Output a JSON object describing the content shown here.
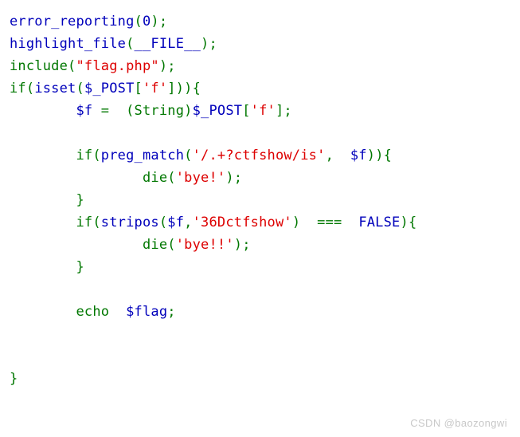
{
  "page": {
    "background_color": "#ffffff",
    "kind": "php-highlighted-source"
  },
  "theme": {
    "identifier_color": "#0000BB",
    "keyword_color": "#007700",
    "string_color": "#DD0000",
    "watermark_color": "#c8c8c8"
  },
  "code": {
    "language": "php",
    "lines": [
      {
        "index": 0,
        "indent": 0,
        "text": "error_reporting(0);",
        "tokens": [
          {
            "t": "error_reporting",
            "c": "fn"
          },
          {
            "t": "(",
            "c": "punc"
          },
          {
            "t": "0",
            "c": "num"
          },
          {
            "t": ")",
            "c": "punc"
          },
          {
            "t": ";",
            "c": "punc"
          }
        ]
      },
      {
        "index": 1,
        "indent": 0,
        "text": "highlight_file(__FILE__);",
        "tokens": [
          {
            "t": "highlight_file",
            "c": "fn"
          },
          {
            "t": "(",
            "c": "punc"
          },
          {
            "t": "__FILE__",
            "c": "def"
          },
          {
            "t": ")",
            "c": "punc"
          },
          {
            "t": ";",
            "c": "punc"
          }
        ]
      },
      {
        "index": 2,
        "indent": 0,
        "text": "include(\"flag.php\");",
        "tokens": [
          {
            "t": "include",
            "c": "kw"
          },
          {
            "t": "(",
            "c": "punc"
          },
          {
            "t": "\"flag.php\"",
            "c": "str"
          },
          {
            "t": ")",
            "c": "punc"
          },
          {
            "t": ";",
            "c": "punc"
          }
        ]
      },
      {
        "index": 3,
        "indent": 0,
        "text": "if(isset($_POST['f'])){",
        "tokens": [
          {
            "t": "if",
            "c": "kw"
          },
          {
            "t": "(",
            "c": "punc"
          },
          {
            "t": "isset",
            "c": "fn"
          },
          {
            "t": "(",
            "c": "punc"
          },
          {
            "t": "$_POST",
            "c": "var"
          },
          {
            "t": "[",
            "c": "punc"
          },
          {
            "t": "'f'",
            "c": "str"
          },
          {
            "t": "]",
            "c": "punc"
          },
          {
            "t": ")",
            "c": "punc"
          },
          {
            "t": ")",
            "c": "punc"
          },
          {
            "t": "{",
            "c": "punc"
          }
        ]
      },
      {
        "index": 4,
        "indent": 1,
        "text": "$f =  (String)$_POST['f'];",
        "tokens": [
          {
            "t": "$f",
            "c": "var"
          },
          {
            "t": " ",
            "c": "plain"
          },
          {
            "t": "=",
            "c": "punc"
          },
          {
            "t": "  ",
            "c": "plain"
          },
          {
            "t": "(String)",
            "c": "punc"
          },
          {
            "t": "$_POST",
            "c": "var"
          },
          {
            "t": "[",
            "c": "punc"
          },
          {
            "t": "'f'",
            "c": "str"
          },
          {
            "t": "]",
            "c": "punc"
          },
          {
            "t": ";",
            "c": "punc"
          }
        ]
      },
      {
        "index": 5,
        "indent": 1,
        "text": "",
        "tokens": []
      },
      {
        "index": 6,
        "indent": 1,
        "text": "if(preg_match('/.+?ctfshow/is', $f)){",
        "tokens": [
          {
            "t": "if",
            "c": "kw"
          },
          {
            "t": "(",
            "c": "punc"
          },
          {
            "t": "preg_match",
            "c": "fn"
          },
          {
            "t": "(",
            "c": "punc"
          },
          {
            "t": "'/.+?ctfshow/is'",
            "c": "str"
          },
          {
            "t": ",",
            "c": "punc"
          },
          {
            "t": "  ",
            "c": "plain"
          },
          {
            "t": "$f",
            "c": "var"
          },
          {
            "t": ")",
            "c": "punc"
          },
          {
            "t": ")",
            "c": "punc"
          },
          {
            "t": "{",
            "c": "punc"
          }
        ]
      },
      {
        "index": 7,
        "indent": 2,
        "text": "die('bye!');",
        "tokens": [
          {
            "t": "die",
            "c": "kw"
          },
          {
            "t": "(",
            "c": "punc"
          },
          {
            "t": "'bye!'",
            "c": "str"
          },
          {
            "t": ")",
            "c": "punc"
          },
          {
            "t": ";",
            "c": "punc"
          }
        ]
      },
      {
        "index": 8,
        "indent": 1,
        "text": "}",
        "tokens": [
          {
            "t": "}",
            "c": "punc"
          }
        ]
      },
      {
        "index": 9,
        "indent": 1,
        "text": "if(stripos($f,'36Dctfshow') === FALSE){",
        "tokens": [
          {
            "t": "if",
            "c": "kw"
          },
          {
            "t": "(",
            "c": "punc"
          },
          {
            "t": "stripos",
            "c": "fn"
          },
          {
            "t": "(",
            "c": "punc"
          },
          {
            "t": "$f",
            "c": "var"
          },
          {
            "t": ",",
            "c": "punc"
          },
          {
            "t": "'36Dctfshow'",
            "c": "str"
          },
          {
            "t": ")",
            "c": "punc"
          },
          {
            "t": "  ",
            "c": "plain"
          },
          {
            "t": "===",
            "c": "punc"
          },
          {
            "t": "  ",
            "c": "plain"
          },
          {
            "t": "FALSE",
            "c": "def"
          },
          {
            "t": ")",
            "c": "punc"
          },
          {
            "t": "{",
            "c": "punc"
          }
        ]
      },
      {
        "index": 10,
        "indent": 2,
        "text": "die('bye!!');",
        "tokens": [
          {
            "t": "die",
            "c": "kw"
          },
          {
            "t": "(",
            "c": "punc"
          },
          {
            "t": "'bye!!'",
            "c": "str"
          },
          {
            "t": ")",
            "c": "punc"
          },
          {
            "t": ";",
            "c": "punc"
          }
        ]
      },
      {
        "index": 11,
        "indent": 1,
        "text": "}",
        "tokens": [
          {
            "t": "}",
            "c": "punc"
          }
        ]
      },
      {
        "index": 12,
        "indent": 1,
        "text": "",
        "tokens": []
      },
      {
        "index": 13,
        "indent": 1,
        "text": "echo $flag;",
        "tokens": [
          {
            "t": "echo",
            "c": "kw"
          },
          {
            "t": "  ",
            "c": "plain"
          },
          {
            "t": "$flag",
            "c": "var"
          },
          {
            "t": ";",
            "c": "punc"
          }
        ]
      },
      {
        "index": 14,
        "indent": 0,
        "text": "",
        "tokens": []
      },
      {
        "index": 15,
        "indent": 0,
        "text": "",
        "tokens": []
      },
      {
        "index": 16,
        "indent": 0,
        "text": "}",
        "tokens": [
          {
            "t": "}",
            "c": "punc"
          }
        ]
      }
    ]
  },
  "watermark": {
    "text": "CSDN @baozongwi"
  }
}
